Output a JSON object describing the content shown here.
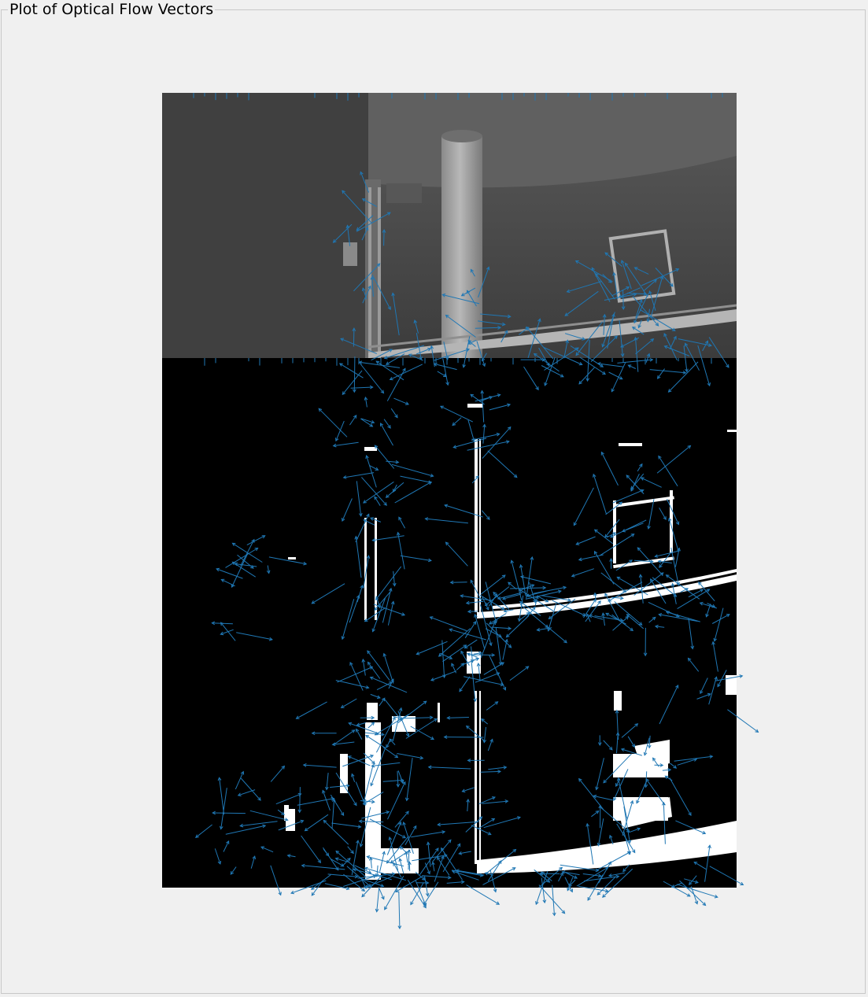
{
  "panel": {
    "title": "Plot of Optical Flow Vectors"
  },
  "plot": {
    "top_image": "grayscale camera frame",
    "bottom_image": "binary edge map",
    "vector_color": "#1f77b4"
  }
}
